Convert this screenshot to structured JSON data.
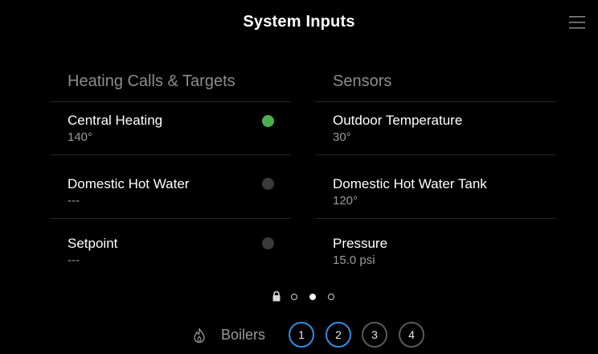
{
  "header": {
    "title": "System Inputs",
    "menu_icon": "hamburger-menu-icon"
  },
  "heating": {
    "title": "Heating Calls & Targets",
    "items": [
      {
        "label": "Central Heating",
        "value": "140°",
        "status_color": "#4caf50"
      },
      {
        "label": "Domestic Hot Water",
        "value": "---",
        "status_color": "#3a3a3a"
      },
      {
        "label": "Setpoint",
        "value": "---",
        "status_color": "#3a3a3a"
      }
    ]
  },
  "sensors": {
    "title": "Sensors",
    "items": [
      {
        "label": "Outdoor Temperature",
        "value": "30°"
      },
      {
        "label": "Domestic Hot Water Tank",
        "value": "120°"
      },
      {
        "label": "Pressure",
        "value": "15.0 psi"
      }
    ]
  },
  "pager": {
    "icon": "lock-icon",
    "pages": 3,
    "active_page": 2
  },
  "boilers": {
    "icon": "flame-icon",
    "label": "Boilers",
    "buttons": [
      {
        "label": "1",
        "selected": true
      },
      {
        "label": "2",
        "selected": true
      },
      {
        "label": "3",
        "selected": false
      },
      {
        "label": "4",
        "selected": false
      }
    ]
  },
  "colors": {
    "background": "#000000",
    "accent": "#2f8fe0",
    "status_on": "#4caf50",
    "status_off": "#3a3a3a"
  }
}
